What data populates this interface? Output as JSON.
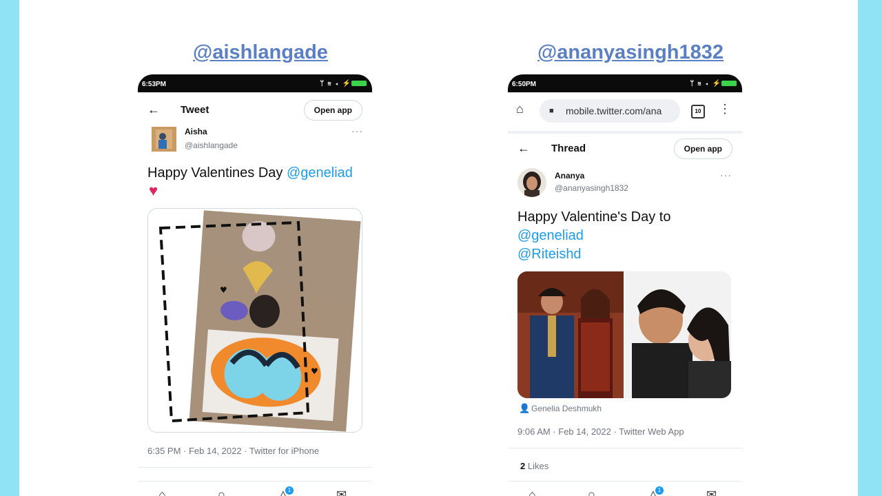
{
  "left": {
    "handle": "@aishlangade",
    "status_time": "6:53PM",
    "nav_title": "Tweet",
    "open_app": "Open app",
    "author_name": "Aisha",
    "author_handle": "@aishlangade",
    "text": "Happy Valentines Day",
    "mention": "@geneliad",
    "heart": "♥",
    "timestamp": "6:35 PM · Feb 14, 2022 · Twitter for iPhone"
  },
  "right": {
    "handle": "@ananyasingh1832",
    "status_time": "6:50PM",
    "url": "mobile.twitter.com/ana",
    "tab_count": "10",
    "nav_title": "Thread",
    "open_app": "Open app",
    "author_name": "Ananya",
    "author_handle": "@ananyasingh1832",
    "text": "Happy Valentine's Day to",
    "mention1": "@geneliad",
    "mention2": "@Riteishd",
    "tagged": "Genelia Deshmukh",
    "timestamp": "9:06 AM · Feb 14, 2022 · Twitter Web App",
    "likes_count": "2",
    "likes_label": "Likes"
  },
  "notification_badge": "1",
  "colors": {
    "background": "#8fe3f5",
    "handle_link": "#5b7fc4",
    "mention": "#1d9bf0",
    "heart": "#e0245e"
  }
}
